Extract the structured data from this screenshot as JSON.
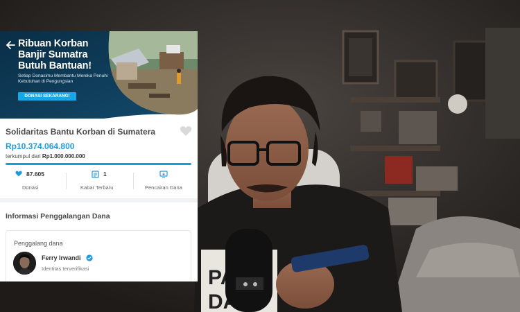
{
  "banner": {
    "title": "Ribuan Korban Banjir Sumatra Butuh Bantuan!",
    "description": "Setiap Donasimu Membantu Mereka Penuhi Kebutuhan di Pengungsian",
    "cta_label": "DONASI SEKARANG!"
  },
  "campaign": {
    "title": "Solidaritas Bantu Korban di Sumatera",
    "amount_collected": "Rp10.374.064.800",
    "target_prefix": "terkumpul dari",
    "target_amount": "Rp1.000.000.000",
    "progress_percent": 100
  },
  "stats": [
    {
      "value": "87.605",
      "label": "Donasi",
      "icon": "heart-icon"
    },
    {
      "value": "1",
      "label": "Kabar Terbaru",
      "icon": "news-icon"
    },
    {
      "value": "",
      "label": "Pencairan Dana",
      "icon": "withdrawal-icon"
    }
  ],
  "info": {
    "section_title": "Informasi Penggalangan Dana",
    "fundraiser_label": "Penggalang dana",
    "fundraiser_name": "Ferry Irwandi",
    "fundraiser_status": "Identitas terverifikasi"
  },
  "colors": {
    "brand_blue": "#1d9be0",
    "banner_navy": "#0f3954",
    "button_blue": "#17a7e6"
  }
}
